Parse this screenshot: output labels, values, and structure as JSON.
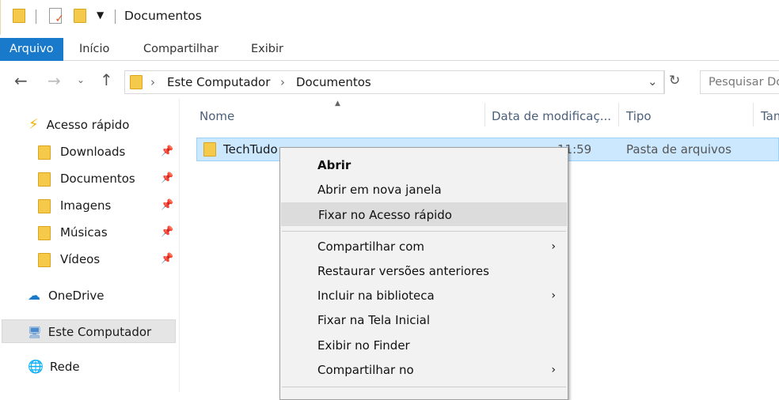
{
  "title": "Documentos",
  "ribbon_tabs": [
    "Arquivo",
    "Início",
    "Compartilhar",
    "Exibir"
  ],
  "address": {
    "crumbs": [
      "Este Computador",
      "Documentos"
    ]
  },
  "search_placeholder": "Pesquisar Documentos",
  "sidebar": {
    "quick_access": "Acesso rápido",
    "pinned": [
      "Downloads",
      "Documentos",
      "Imagens",
      "Músicas",
      "Vídeos"
    ],
    "onedrive": "OneDrive",
    "this_pc": "Este Computador",
    "network": "Rede"
  },
  "columns": [
    "Nome",
    "Data de modificaç...",
    "Tipo",
    "Tamanho"
  ],
  "file": {
    "name": "TechTudo",
    "date_visible": "11:59",
    "type": "Pasta de arquivos"
  },
  "menu": [
    {
      "label": "Abrir"
    },
    {
      "label": "Abrir em nova janela"
    },
    {
      "label": "Fixar no Acesso rápido"
    },
    {
      "label": "Compartilhar com",
      "submenu": true
    },
    {
      "label": "Restaurar versões anteriores"
    },
    {
      "label": "Incluir na biblioteca",
      "submenu": true
    },
    {
      "label": "Fixar na Tela Inicial"
    },
    {
      "label": "Exibir no Finder"
    },
    {
      "label": "Compartilhar no",
      "submenu": true
    }
  ],
  "colors": {
    "accent": "#1979ca",
    "selection": "#cce8ff"
  }
}
